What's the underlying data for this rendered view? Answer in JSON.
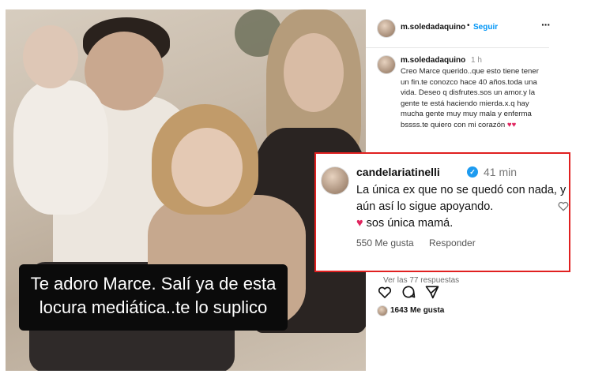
{
  "photo": {
    "caption_lines": [
      "Te adoro Marce. Salí ya de  esta",
      "locura mediática..te lo suplico"
    ]
  },
  "header": {
    "username": "m.soledadaquino",
    "separator": "•",
    "follow_label": "Seguir",
    "more_label": "···"
  },
  "post": {
    "username": "m.soledadaquino",
    "time": "1 h",
    "text": "Creo Marce querido..que esto tiene tener un fin.te conozco hace 40 años.toda una vida.  Deseo q disfrutes.sos un amor.y la gente te está haciendo mierda.x.q hay mucha gente muy muy mala y enferma bssss.te quiero con mi corazón",
    "hearts": "♥♥"
  },
  "comment": {
    "username": "candelariatinelli",
    "verified_mark": "✓",
    "time": "41 min",
    "text": "La única ex que no se quedó con nada, y aún así lo sigue apoyando.",
    "heart": "♥",
    "text_end": " sos única mamá.",
    "likes_label": "550 Me gusta",
    "reply_label": "Responder"
  },
  "replies_peek": "Ver las 77 respuestas",
  "likes": {
    "label": "1643 Me gusta"
  },
  "icons": [
    "heart-icon",
    "comment-icon",
    "share-icon",
    "more-icon",
    "verified-icon"
  ],
  "colors": {
    "accent": "#0095f6",
    "highlight_border": "#e02020",
    "heart": "#e0245e",
    "verified": "#1d9bf0"
  }
}
